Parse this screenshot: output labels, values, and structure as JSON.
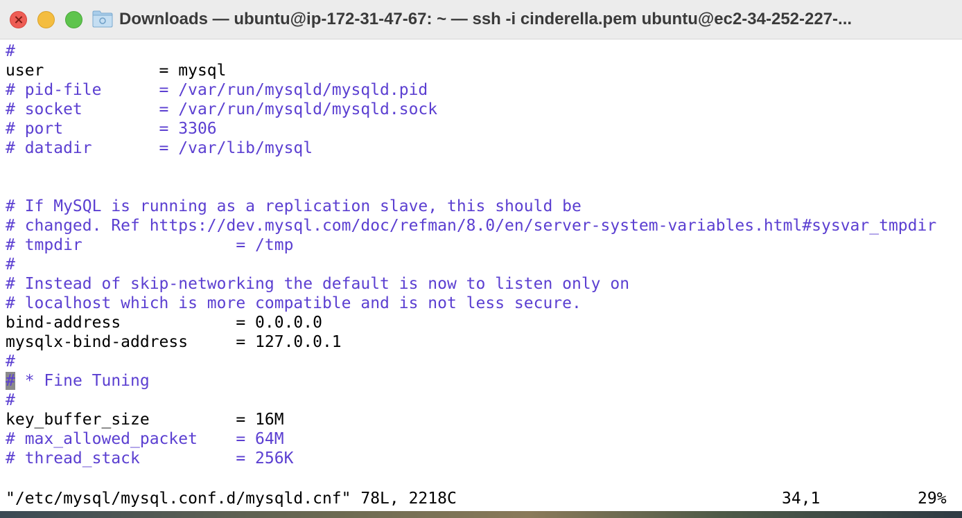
{
  "window": {
    "title": "Downloads — ubuntu@ip-172-31-47-67: ~ — ssh -i cinderella.pem ubuntu@ec2-34-252-227-..."
  },
  "icons": {
    "close": "close-icon",
    "minimize": "minimize-icon",
    "maximize": "maximize-icon",
    "folder": "folder-icon"
  },
  "colors": {
    "comment": "#5b3fd1",
    "text": "#000000",
    "close": "#ee5d55",
    "minimize": "#f4bd40",
    "maximize": "#5ec44d"
  },
  "editor": {
    "lines": [
      {
        "text": "#",
        "type": "comment"
      },
      {
        "text": "user            = mysql",
        "type": "normal"
      },
      {
        "text": "# pid-file      = /var/run/mysqld/mysqld.pid",
        "type": "comment"
      },
      {
        "text": "# socket        = /var/run/mysqld/mysqld.sock",
        "type": "comment"
      },
      {
        "text": "# port          = 3306",
        "type": "comment"
      },
      {
        "text": "# datadir       = /var/lib/mysql",
        "type": "comment"
      },
      {
        "text": "",
        "type": "normal"
      },
      {
        "text": "",
        "type": "normal"
      },
      {
        "text": "# If MySQL is running as a replication slave, this should be",
        "type": "comment"
      },
      {
        "text": "# changed. Ref https://dev.mysql.com/doc/refman/8.0/en/server-system-variables.html#sysvar_tmpdir",
        "type": "comment"
      },
      {
        "text": "# tmpdir                = /tmp",
        "type": "comment"
      },
      {
        "text": "#",
        "type": "comment"
      },
      {
        "text": "# Instead of skip-networking the default is now to listen only on",
        "type": "comment"
      },
      {
        "text": "# localhost which is more compatible and is not less secure.",
        "type": "comment"
      },
      {
        "text": "bind-address            = 0.0.0.0",
        "type": "normal"
      },
      {
        "text": "mysqlx-bind-address     = 127.0.0.1",
        "type": "normal"
      },
      {
        "text": "#",
        "type": "comment"
      },
      {
        "text": "# * Fine Tuning",
        "type": "cursor-line"
      },
      {
        "text": "#",
        "type": "comment"
      },
      {
        "text": "key_buffer_size         = 16M",
        "type": "normal"
      },
      {
        "text": "# max_allowed_packet    = 64M",
        "type": "comment"
      },
      {
        "text": "# thread_stack          = 256K",
        "type": "comment"
      }
    ],
    "cursor_line_rest": " * Fine Tuning",
    "cursor_char": "#"
  },
  "status": {
    "file_info": "\"/etc/mysql/mysql.conf.d/mysqld.cnf\" 78L, 2218C",
    "position": "34,1",
    "percent": "29%"
  }
}
